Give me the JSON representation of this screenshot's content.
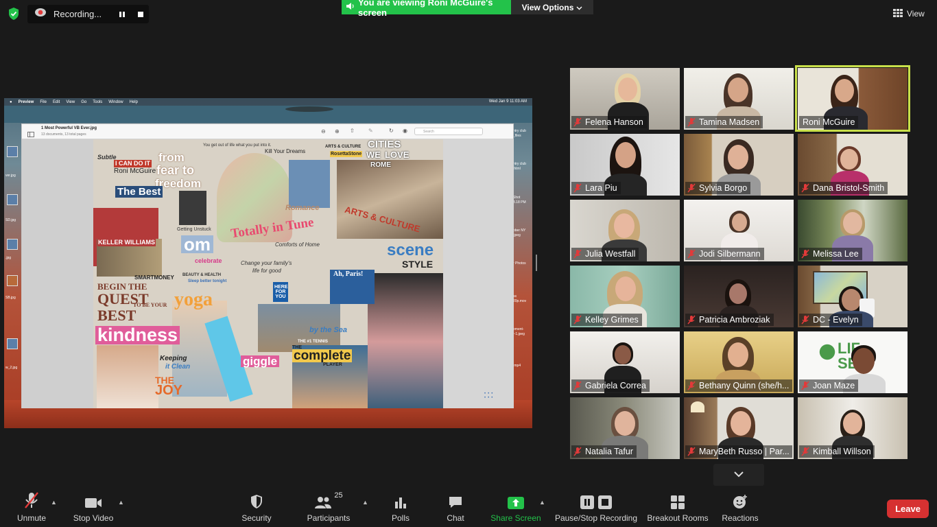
{
  "colors": {
    "background": "#1a1a1a",
    "accent_green": "#23c24a",
    "leave_red": "#d63131",
    "active_speaker": "#c9e04a",
    "mic_muted_red": "#e23a3a"
  },
  "top_bar": {
    "security_icon": "shield-check-icon",
    "recording_label": "Recording...",
    "viewing_banner": "You are viewing Roni McGuire's screen",
    "view_options": "View Options",
    "view_label": "View"
  },
  "shared_screen": {
    "menubar": [
      "Preview",
      "File",
      "Edit",
      "View",
      "Go",
      "Tools",
      "Window",
      "Help"
    ],
    "clock": "Wed Jan 9  11:03 AM",
    "document_title": "1 Most Powerful VB Ever.jpg",
    "document_subtitle": "13 documents, 13 total pages",
    "search_placeholder": "Search",
    "collage_text": {
      "i_can_do_it": "I CAN DO IT",
      "name": "Roni McGuire",
      "from": "from",
      "fear_to": "fear to",
      "freedom": "freedom",
      "kill_dreams": "Kill Your Dreams",
      "arts_culture_small": "ARTS & CULTURE",
      "rosetta": "RosettaStone",
      "cities": "CITIES",
      "we_love": "WE",
      "love": "LOVE",
      "rome": "ROME",
      "the_best": "The Best",
      "romance": "Romance",
      "arts_culture": "ARTS & CULTURE",
      "totally_in_tune": "Totally in Tune",
      "om": "om",
      "keller_williams": "KELLER WILLIAMS",
      "scene": "scene",
      "style": "STYLE",
      "smartmoney": "SMARTMONEY",
      "begin_the": "BEGIN THE",
      "quest": "QUEST",
      "to_be": "TO BE YOUR",
      "best": "BEST",
      "yoga": "yoga",
      "kindness": "kindness",
      "ah_paris": "Ah, Paris!",
      "by_the_sea": "by the Sea",
      "the_complete": "THE",
      "complete": "complete",
      "player": "PLAYER",
      "giggle": "giggle",
      "keeping": "Keeping",
      "it_clean": "it Clean",
      "joy": "JOY",
      "the_joy": "THE",
      "celebrate": "celebrate",
      "change_family": "Change your family's",
      "life_for_good": "life for good",
      "sleep_better": "Sleep better tonight",
      "beauty_health": "BEAUTY & HEALTH",
      "getting_unstuck": "Getting Unstuck",
      "here_for_you": "HERE FOR YOU",
      "tennis": "THE #1 TENNIS",
      "subtle": "Subtle",
      "comforts": "Comforts of Home",
      "you_get_out": "You get out of life what you put into it."
    },
    "desktop_labels_left": [
      "ver.jpg",
      "SD.jpg",
      ".jpg",
      "SB.jpg",
      "w_2.jpg"
    ],
    "desktop_labels_right": [
      "ntry club",
      "_files",
      "ntry club",
      ".html",
      "Shot",
      "3.18 PM",
      "ober NY",
      ".jpeg",
      "r Photos",
      "ss",
      "20p.mov",
      "ement-",
      "r-1.jpeg",
      ".mp4"
    ]
  },
  "participants": [
    {
      "name": "Felena Hanson"
    },
    {
      "name": "Tamina Madsen"
    },
    {
      "name": "Roni McGuire"
    },
    {
      "name": "Lara Piu"
    },
    {
      "name": "Sylvia Borgo"
    },
    {
      "name": "Dana Bristol-Smith"
    },
    {
      "name": "Julia Westfall"
    },
    {
      "name": "Jodi Silbermann"
    },
    {
      "name": "Melissa Lee"
    },
    {
      "name": "Kelley Grimes"
    },
    {
      "name": "Patricia Ambroziak"
    },
    {
      "name": "DC - Evelyn"
    },
    {
      "name": "Gabriela Correa"
    },
    {
      "name": "Bethany Quinn (she/h..."
    },
    {
      "name": "Joan Maze"
    },
    {
      "name": "Natalia Tafur"
    },
    {
      "name": "MaryBeth Russo | Par..."
    },
    {
      "name": "Kimball Willson"
    }
  ],
  "joan_bg_logo": {
    "l1": "LIF",
    "l2": "SE"
  },
  "toolbar": {
    "unmute": "Unmute",
    "stop_video": "Stop Video",
    "security": "Security",
    "participants": "Participants",
    "participants_count": "25",
    "polls": "Polls",
    "chat": "Chat",
    "share_screen": "Share Screen",
    "pause_stop_recording": "Pause/Stop Recording",
    "breakout_rooms": "Breakout Rooms",
    "reactions": "Reactions",
    "leave": "Leave"
  }
}
